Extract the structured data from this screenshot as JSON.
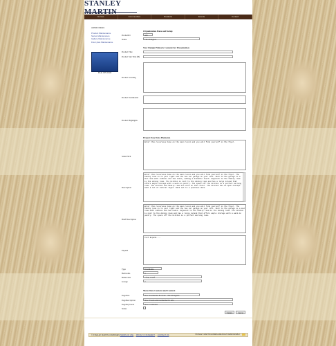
{
  "brand": {
    "logo_text": "STANLEY MARTIN"
  },
  "nav": {
    "items": [
      "Homes",
      "Communities",
      "Products",
      "Events",
      "Contact"
    ]
  },
  "admin": {
    "title": "ADMIN MENU",
    "links": [
      "Product Maintenance",
      "Series Maintenance",
      "Gallery Maintenance",
      "Floor plan Maintenance"
    ],
    "thumb_caption": "FILE UPLOAD"
  },
  "form": {
    "sections": {
      "org": "Organization Data and Setup",
      "new_design": "New Design Primary Content for Presentation",
      "key_data": "Project Key Data Elements",
      "meta": "Meta Data Content and Control"
    },
    "labels": {
      "product_id": "ProductID",
      "name": "Name",
      "product_title": "Product Title",
      "product_sub_title": "Product Sub Title (H)",
      "product_greeting": "Product Greeting",
      "product_testimonial": "Product Testimonial",
      "product_highlights": "Product Highlights",
      "sales_pitch": "Sales Pitch",
      "description": "Description",
      "brief_description": "Brief Description",
      "expand": "Expand",
      "type": "Type",
      "bedrooms": "Bedrooms",
      "bathrooms": "Bathrooms",
      "garage": "Garage",
      "page_title": "PageTitle",
      "page_description": "PageDescription",
      "page_keywords": "PageKeywords",
      "status": "Status"
    },
    "values": {
      "product_id": "443",
      "name": "The Abingdon",
      "sales_pitch": "Enter this luxurious home on the main level and you will find yourself in the foyer.",
      "description": "Enter this luxurious home on the main level and you will find yourself in the foyer. The family room is to your right and the two car garage on your left. Next to the garage is a mud room with cubbies and two nooks, adding a dramatic touch. Adjacent to the family room is the dining room. The kitchen is next to the dining room and has a large island that offers ample storage with a walk-in pantry. The space off the kitchen is a perfect morning room. The kitchen and family room are also on this floor. The kitchen has an open concept with a lot of natural light. Walk out to a spacious deck.",
      "brief_description": "Enter this luxurious home on the main level and you will find yourself in the foyer. The family room is to your right and the two car garage on your left. Next to the garage is a mud room with cubbies and two nooks. Adjacent to the family room is the dining room. The kitchen is next to the dining room and has a large island that offers ample storage with a walk-in pantry. The space off the kitchen is a perfect morning room.",
      "expand": "Text Expand....",
      "type": "Townhome",
      "bedrooms": "3",
      "bathrooms": "2 full, 1 half",
      "garage": "2",
      "page_title": "New Townhome For Sale - The Abingdon",
      "page_description": "New 3 bedroom townhome for sale",
      "page_keywords": "New townhome",
      "update": "Update",
      "cancel": "Cancel"
    }
  },
  "footer": {
    "copyright": "© STANLEY MARTIN COMPANIES",
    "links": [
      "TERMS OF USE",
      "PRIVACY STATEMENT",
      "CONTACT US"
    ],
    "right_text": "STANLEY MARTIN HOMES ARE BUILT RESPONSIBLY"
  }
}
